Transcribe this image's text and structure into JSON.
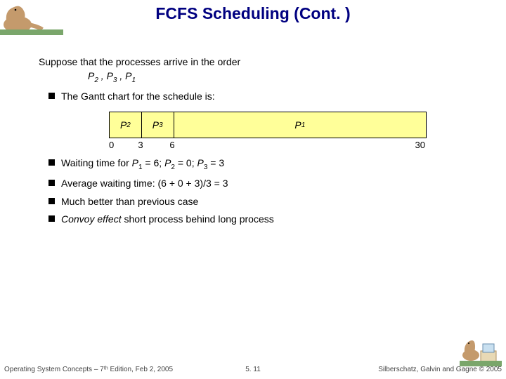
{
  "title": "FCFS Scheduling (Cont. )",
  "intro": "Suppose that the processes arrive in the order",
  "order_parts": {
    "p2": "P",
    "s2": "2",
    "c1": " , ",
    "p3": "P",
    "s3": "3",
    "c2": " , ",
    "p1": "P",
    "s1": "1"
  },
  "bullets": {
    "b1": "The Gantt chart for the schedule is:",
    "b2_pre": "Waiting time for ",
    "b2_p1": "P",
    "b2_s1": "1",
    "b2_v1": " = 6; ",
    "b2_p2": "P",
    "b2_s2": "2",
    "b2_v2": " = 0",
    "b2_sep": "; ",
    "b2_p3": "P",
    "b2_s3": "3",
    "b2_v3": " = 3",
    "b3": "Average waiting time:   (6 + 0 + 3)/3 = 3",
    "b4": "Much better than previous case",
    "b5_em": "Convoy effect",
    "b5_rest": " short process behind long process"
  },
  "chart_data": {
    "type": "bar",
    "title": "Gantt chart",
    "xlabel": "time",
    "xlim": [
      0,
      30
    ],
    "segments": [
      {
        "label": "P",
        "sub": "2",
        "start": 0,
        "end": 3
      },
      {
        "label": "P",
        "sub": "3",
        "start": 3,
        "end": 6
      },
      {
        "label": "P",
        "sub": "1",
        "start": 6,
        "end": 30
      }
    ],
    "ticks": [
      0,
      3,
      6,
      30
    ]
  },
  "footer": {
    "left": "Operating System Concepts – 7ᵗʰ Edition, Feb 2, 2005",
    "center": "5. 11",
    "right": "Silberschatz, Galvin and Gagne © 2005"
  }
}
